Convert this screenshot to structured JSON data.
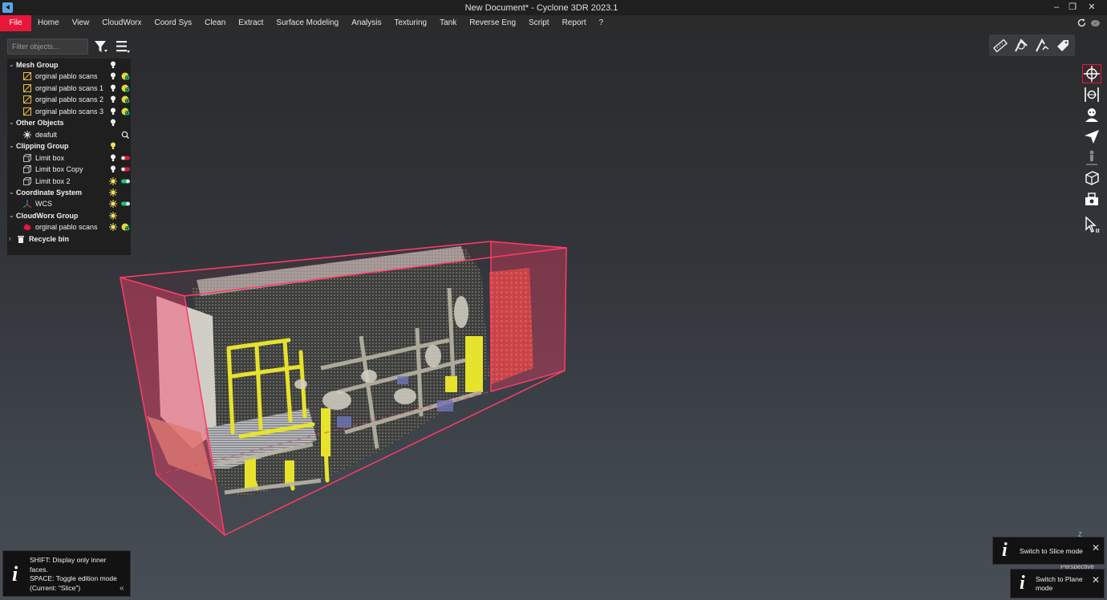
{
  "window": {
    "title": "New Document* - Cyclone 3DR 2023.1",
    "controls": [
      "–",
      "❐",
      "✕"
    ]
  },
  "menu": {
    "items": [
      "File",
      "Home",
      "View",
      "CloudWorx",
      "Coord Sys",
      "Clean",
      "Extract",
      "Surface Modeling",
      "Analysis",
      "Texturing",
      "Tank",
      "Reverse Eng",
      "Script",
      "Report",
      "?"
    ]
  },
  "panel": {
    "filter_placeholder": "Filter objects...",
    "tree": [
      {
        "type": "group",
        "label": "Mesh Group",
        "vis": "bulb"
      },
      {
        "type": "child",
        "label": "orginal pablo scans",
        "icon": "mesh-icon",
        "vis": "bulb",
        "state": "cloud"
      },
      {
        "type": "child",
        "label": "orginal pablo scans 1",
        "icon": "mesh-icon",
        "vis": "bulb",
        "state": "cloud"
      },
      {
        "type": "child",
        "label": "orginal pablo scans 2",
        "icon": "mesh-icon",
        "vis": "bulb",
        "state": "cloud"
      },
      {
        "type": "child",
        "label": "orginal pablo scans 3",
        "icon": "mesh-icon",
        "vis": "bulb",
        "state": "cloud"
      },
      {
        "type": "group",
        "label": "Other Objects",
        "vis": "bulb"
      },
      {
        "type": "child",
        "label": "deafult",
        "icon": "light-icon",
        "vis": "none",
        "state": "search"
      },
      {
        "type": "group",
        "label": "Clipping Group",
        "vis": "bulb-yellow"
      },
      {
        "type": "child",
        "label": "Limit box",
        "icon": "box-icon",
        "vis": "bulb",
        "state": "off"
      },
      {
        "type": "child",
        "label": "Limit box Copy",
        "icon": "box-icon",
        "vis": "bulb",
        "state": "off"
      },
      {
        "type": "child",
        "label": "Limit box 2",
        "icon": "box-icon",
        "vis": "sun",
        "state": "on"
      },
      {
        "type": "group",
        "label": "Coordinate System",
        "vis": "sun"
      },
      {
        "type": "child",
        "label": "WCS",
        "icon": "axes-icon",
        "vis": "sun",
        "state": "on"
      },
      {
        "type": "group",
        "label": "CloudWorx Group",
        "vis": "sun"
      },
      {
        "type": "child",
        "label": "orginal pablo scans",
        "icon": "cloudworx-icon",
        "vis": "sun",
        "state": "cloud"
      },
      {
        "type": "group",
        "label": "Recycle bin",
        "vis": "none",
        "icon": "trash-icon"
      }
    ]
  },
  "tip": {
    "lines": [
      "SHIFT: Display only inner",
      "faces.",
      "SPACE: Toggle edition mode",
      "(Current: \"Slice\")"
    ]
  },
  "toasts": {
    "slice": "Switch to Slice mode",
    "plane_line1": "Switch to Plane",
    "plane_line2": "mode"
  },
  "viewport": {
    "projection_label": "Perspective",
    "axis_label": "Z"
  },
  "colors": {
    "accent": "#e8173a",
    "clip_box": "#ff3b67",
    "toggle_on": "#1fbf7a",
    "toggle_off": "#d3203a",
    "bulb_yellow": "#f6e05a"
  }
}
